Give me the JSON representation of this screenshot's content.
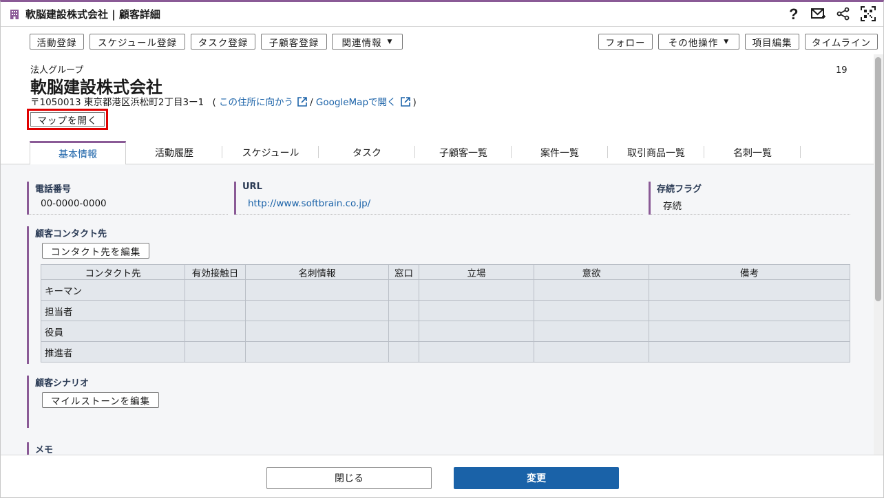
{
  "window": {
    "title": "軟脳建設株式会社 | 顧客詳細",
    "icons": [
      "building-icon",
      "help-icon",
      "mail-icon",
      "share-icon",
      "qr-code-icon"
    ]
  },
  "toolbar": {
    "activity_register": "活動登録",
    "schedule_register": "スケジュール登録",
    "task_register": "タスク登録",
    "child_customer_register": "子顧客登録",
    "related_info": "関連情報",
    "follow": "フォロー",
    "other_actions": "その他操作",
    "item_edit": "項目編集",
    "timeline": "タイムライン"
  },
  "header": {
    "group": "法人グループ",
    "company": "軟脳建設株式会社",
    "count": "19",
    "address": "〒1050013 東京都港区浜松町2丁目3ー1",
    "paren_open": "(",
    "directions_link": "この住所に向かう",
    "slash": "/",
    "googlemap_link": "GoogleMapで開く",
    "paren_close": ")",
    "open_map_button": "マップを開く"
  },
  "tabs": [
    "基本情報",
    "活動履歴",
    "スケジュール",
    "タスク",
    "子顧客一覧",
    "案件一覧",
    "取引商品一覧",
    "名刺一覧"
  ],
  "fields": {
    "phone_label": "電話番号",
    "phone_value": "00-0000-0000",
    "url_label": "URL",
    "url_value": "http://www.softbrain.co.jp/",
    "continuity_label": "存続フラグ",
    "continuity_value": "存続"
  },
  "contacts": {
    "label": "顧客コンタクト先",
    "edit_button": "コンタクト先を編集",
    "columns": [
      "コンタクト先",
      "有効接触日",
      "名刺情報",
      "窓口",
      "立場",
      "意欲",
      "備考"
    ],
    "rows": [
      "キーマン",
      "担当者",
      "役員",
      "推進者"
    ]
  },
  "scenario": {
    "label": "顧客シナリオ",
    "edit_button": "マイルストーンを編集"
  },
  "memo": {
    "label": "メモ"
  },
  "footer": {
    "close": "閉じる",
    "change": "変更"
  },
  "colors": {
    "accent": "#8a5a96",
    "link": "#1a62a8",
    "primary_button": "#1a62a8",
    "highlight": "#e00000"
  }
}
